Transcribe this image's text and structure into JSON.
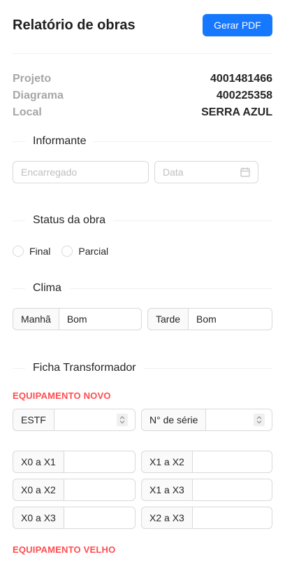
{
  "header": {
    "title": "Relatório de obras",
    "pdf_button": "Gerar PDF"
  },
  "info": [
    {
      "label": "Projeto",
      "value": "4001481466"
    },
    {
      "label": "Diagrama",
      "value": "400225358"
    },
    {
      "label": "Local",
      "value": "SERRA AZUL"
    }
  ],
  "informante": {
    "heading": "Informante",
    "encarregado_placeholder": "Encarregado",
    "data_placeholder": "Data"
  },
  "status": {
    "heading": "Status da obra",
    "options": [
      "Final",
      "Parcial"
    ]
  },
  "clima": {
    "heading": "Clima",
    "manha_label": "Manhã",
    "manha_value": "Bom",
    "tarde_label": "Tarde",
    "tarde_value": "Bom"
  },
  "transformador": {
    "heading": "Ficha Transformador",
    "novo_label": "EQUIPAMENTO NOVO",
    "estf_label": "ESTF",
    "serie_label": "N° de série",
    "fields": [
      "X0 a X1",
      "X1 a X2",
      "X0 a X2",
      "X1 a X3",
      "X0 a X3",
      "X2 a X3"
    ],
    "velho_label": "EQUIPAMENTO VELHO"
  }
}
